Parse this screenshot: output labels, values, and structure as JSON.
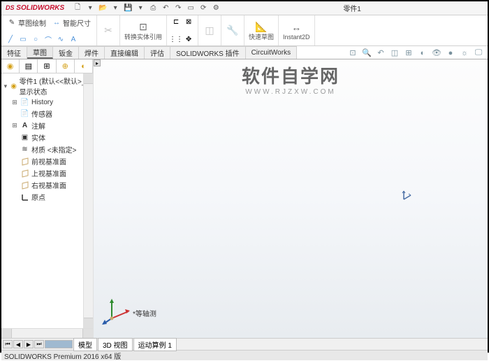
{
  "titlebar": {
    "logo_ds": "DS",
    "logo_text": "SOLIDWORKS",
    "doc_title": "零件1"
  },
  "ribbon": {
    "sketch_btn": "草图绘制",
    "smartdim_btn": "智能尺寸",
    "convert_btn": "转换实体引用",
    "quick_sketch": "快速草图",
    "instant2d": "Instant2D"
  },
  "tabs": [
    "特征",
    "草图",
    "钣金",
    "焊件",
    "直接编辑",
    "评估",
    "SOLIDWORKS 插件",
    "CircuitWorks"
  ],
  "active_tab": 1,
  "tree": {
    "root": "零件1 (默认<<默认>_显示状态",
    "nodes": [
      {
        "label": "History",
        "exp": "⊞",
        "icon": "📄"
      },
      {
        "label": "传感器",
        "exp": "",
        "icon": "📄"
      },
      {
        "label": "注解",
        "exp": "⊞",
        "icon": "A"
      },
      {
        "label": "实体",
        "exp": "",
        "icon": "▣"
      },
      {
        "label": "材质 <未指定>",
        "exp": "",
        "icon": "≋"
      },
      {
        "label": "前视基准面",
        "exp": "",
        "icon": "plane"
      },
      {
        "label": "上视基准面",
        "exp": "",
        "icon": "plane"
      },
      {
        "label": "右视基准面",
        "exp": "",
        "icon": "plane"
      },
      {
        "label": "原点",
        "exp": "",
        "icon": "origin"
      }
    ]
  },
  "axotext": "*等轴测",
  "bottom_tabs": [
    "模型",
    "3D 视图",
    "运动算例 1"
  ],
  "statusbar": "SOLIDWORKS Premium 2016 x64 版",
  "watermark": {
    "line1": "软件自学网",
    "line2": "WWW.RJZXW.COM"
  }
}
